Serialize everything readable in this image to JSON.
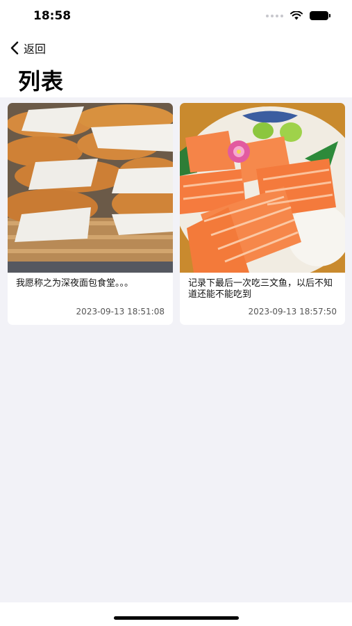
{
  "status_bar": {
    "time": "18:58"
  },
  "nav": {
    "back_label": "返回",
    "title": "列表"
  },
  "posts": [
    {
      "text": "我愿称之为深夜面包食堂。。。",
      "date": "2023-09-13 18:51:08",
      "image": "bread-photo"
    },
    {
      "text": "记录下最后一次吃三文鱼，以后不知道还能不能吃到",
      "date": "2023-09-13 18:57:50",
      "image": "salmon-photo"
    }
  ],
  "colors": {
    "background": "#f2f2f7",
    "card": "#ffffff"
  }
}
